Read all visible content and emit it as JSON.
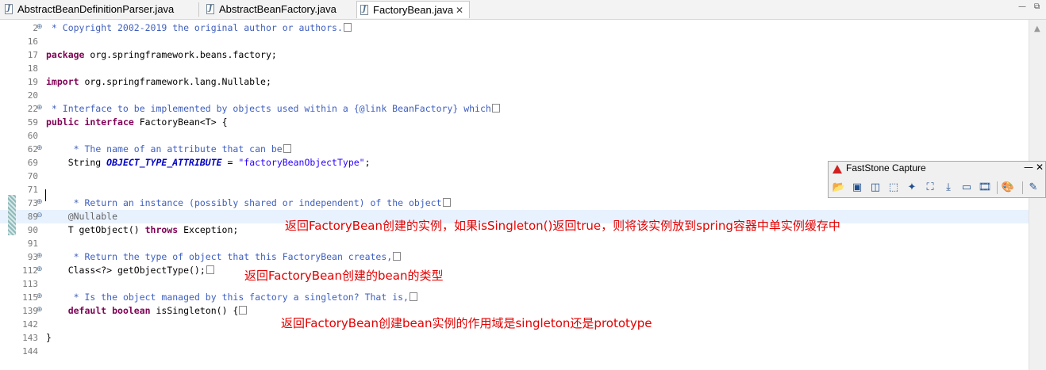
{
  "tabs": [
    {
      "label": "AbstractBeanDefinitionParser.java",
      "active": false
    },
    {
      "label": "AbstractBeanFactory.java",
      "active": false
    },
    {
      "label": "FactoryBean.java",
      "active": true
    }
  ],
  "tab_close_glyph": "✕",
  "window_controls": {
    "minimize": "—",
    "restore": "⧉"
  },
  "code_lines": [
    {
      "num": "2",
      "fold": "⊕",
      "html": "<span class=\"cm\"> * Copyright 2002-2019 the original author or authors.</span><span class=\"box\"></span>"
    },
    {
      "num": "16",
      "fold": "",
      "html": ""
    },
    {
      "num": "17",
      "fold": "",
      "html": "<span class=\"kw\">package</span> org.springframework.beans.factory;"
    },
    {
      "num": "18",
      "fold": "",
      "html": ""
    },
    {
      "num": "19",
      "fold": "",
      "html": "<span class=\"kw\">import</span> org.springframework.lang.Nullable;"
    },
    {
      "num": "20",
      "fold": "",
      "html": ""
    },
    {
      "num": "22",
      "fold": "⊕",
      "html": "<span class=\"cm\"> * Interface to be implemented by objects used within a {@link BeanFactory} which</span><span class=\"box\"></span>"
    },
    {
      "num": "59",
      "fold": "",
      "html": "<span class=\"kw\">public</span> <span class=\"kw\">interface</span> FactoryBean&lt;T&gt; {"
    },
    {
      "num": "60",
      "fold": "",
      "html": ""
    },
    {
      "num": "62",
      "fold": "⊕",
      "html": "    <span class=\"cm\"> * The name of an attribute that can be</span><span class=\"box\"></span>"
    },
    {
      "num": "69",
      "fold": "",
      "html": "    String <span class=\"fld\">OBJECT_TYPE_ATTRIBUTE</span> = <span class=\"str\">\"factoryBeanObjectType\"</span>;"
    },
    {
      "num": "70",
      "fold": "",
      "html": ""
    },
    {
      "num": "71",
      "fold": "",
      "html": ""
    },
    {
      "num": "73",
      "fold": "⊕",
      "html": "    <span class=\"cm\"> * Return an instance (possibly shared or independent) of the object</span><span class=\"box\"></span>"
    },
    {
      "num": "89",
      "fold": "⊖",
      "html": "    <span class=\"ann\">@Nullable</span>",
      "highlight": true
    },
    {
      "num": "90",
      "fold": "",
      "html": "    T getObject() <span class=\"kw\">throws</span> Exception;"
    },
    {
      "num": "91",
      "fold": "",
      "html": ""
    },
    {
      "num": "93",
      "fold": "⊕",
      "html": "    <span class=\"cm\"> * Return the type of object that this FactoryBean creates,</span><span class=\"box\"></span>"
    },
    {
      "num": "112",
      "fold": "⊕",
      "html": "    Class&lt;?&gt; getObjectType();<span class=\"box\"></span>"
    },
    {
      "num": "113",
      "fold": "",
      "html": ""
    },
    {
      "num": "115",
      "fold": "⊕",
      "html": "    <span class=\"cm\"> * Is the object managed by this factory a singleton? That is,</span><span class=\"box\"></span>"
    },
    {
      "num": "139",
      "fold": "⊕",
      "html": "    <span class=\"kw\">default</span> <span class=\"kw\">boolean</span> isSingleton() {<span class=\"box\"></span>"
    },
    {
      "num": "142",
      "fold": "",
      "html": ""
    },
    {
      "num": "143",
      "fold": "",
      "html": "}"
    },
    {
      "num": "144",
      "fold": "",
      "html": ""
    }
  ],
  "notes": [
    "返回FactoryBean创建的实例，如果isSingleton()返回true，则将该实例放到spring容器中单实例缓存中",
    "返回FactoryBean创建的bean的类型",
    "返回FactoryBean创建bean实例的作用域是singleton还是prototype"
  ],
  "colors": {
    "keyword": "#7f0055",
    "comment": "#3f5fbf",
    "string": "#2a00ff",
    "note": "#e30000",
    "current_line": "#e8f2fe"
  },
  "faststone": {
    "title": "FastStone Capture",
    "minimize": "—",
    "close": "✕",
    "tools": [
      {
        "icon": "open-folder-icon",
        "glyph": "📂"
      },
      {
        "icon": "capture-window-icon",
        "glyph": "▣"
      },
      {
        "icon": "capture-object-icon",
        "glyph": "◫"
      },
      {
        "icon": "capture-rectangle-icon",
        "glyph": "⬚"
      },
      {
        "icon": "capture-freehand-icon",
        "glyph": "✦"
      },
      {
        "icon": "capture-fullscreen-icon",
        "glyph": "⛶"
      },
      {
        "icon": "capture-scrolling-icon",
        "glyph": "⤓"
      },
      {
        "icon": "capture-fixed-region-icon",
        "glyph": "▭"
      },
      {
        "icon": "screen-recorder-icon",
        "glyph": "🎞"
      },
      {
        "icon": "output-options-icon",
        "glyph": "🎨"
      },
      {
        "icon": "settings-icon",
        "glyph": "✎"
      }
    ]
  }
}
